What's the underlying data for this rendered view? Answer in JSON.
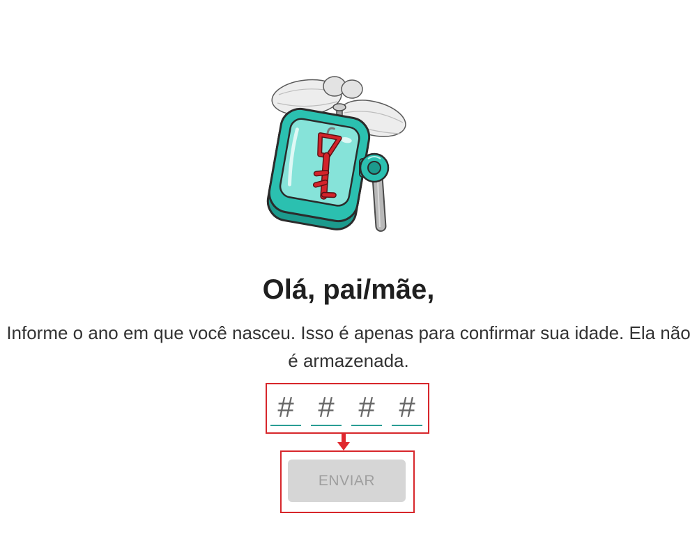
{
  "illustration": "flying-lock-key-icon",
  "greeting": {
    "heading": "Olá, pai/mãe,",
    "description": "Informe o ano em que você nasceu. Isso é apenas para confirmar sua idade. Ela não é armazenada."
  },
  "birth_year": {
    "digits": [
      {
        "placeholder": "#"
      },
      {
        "placeholder": "#"
      },
      {
        "placeholder": "#"
      },
      {
        "placeholder": "#"
      }
    ]
  },
  "submit_button": {
    "label": "ENVIAR",
    "disabled": true
  },
  "annotations": {
    "arrow_icon": "down-arrow-icon"
  },
  "colors": {
    "heading": "#1f1f1f",
    "text": "#333333",
    "input_underline": "#2a9d94",
    "placeholder": "#666666",
    "button_bg": "#d6d6d6",
    "button_text": "#9e9e9e",
    "annotation": "#d7262b",
    "lock_body": "#2bc0b0",
    "key": "#d3232a"
  }
}
